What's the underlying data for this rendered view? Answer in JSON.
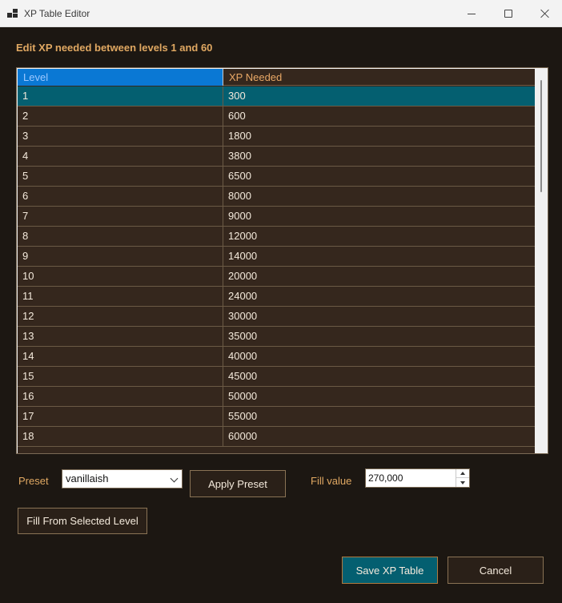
{
  "window": {
    "title": "XP Table Editor",
    "icon": "app-icon"
  },
  "heading": "Edit XP needed between levels 1 and 60",
  "grid": {
    "columns": [
      "Level",
      "XP Needed"
    ],
    "selected_row": 0,
    "rows": [
      {
        "level": "1",
        "xp": "300"
      },
      {
        "level": "2",
        "xp": "600"
      },
      {
        "level": "3",
        "xp": "1800"
      },
      {
        "level": "4",
        "xp": "3800"
      },
      {
        "level": "5",
        "xp": "6500"
      },
      {
        "level": "6",
        "xp": "8000"
      },
      {
        "level": "7",
        "xp": "9000"
      },
      {
        "level": "8",
        "xp": "12000"
      },
      {
        "level": "9",
        "xp": "14000"
      },
      {
        "level": "10",
        "xp": "20000"
      },
      {
        "level": "11",
        "xp": "24000"
      },
      {
        "level": "12",
        "xp": "30000"
      },
      {
        "level": "13",
        "xp": "35000"
      },
      {
        "level": "14",
        "xp": "40000"
      },
      {
        "level": "15",
        "xp": "45000"
      },
      {
        "level": "16",
        "xp": "50000"
      },
      {
        "level": "17",
        "xp": "55000"
      },
      {
        "level": "18",
        "xp": "60000"
      }
    ]
  },
  "preset": {
    "label": "Preset",
    "value": "vanillaish"
  },
  "apply_preset_label": "Apply Preset",
  "fill": {
    "label": "Fill value",
    "value": "270,000"
  },
  "fill_from_selected_label": "Fill From Selected Level",
  "save_label": "Save XP Table",
  "cancel_label": "Cancel",
  "colors": {
    "background": "#1c1712",
    "grid_row": "#35271d",
    "selected_row": "#045f70",
    "header_selected": "#0a78d4",
    "accent_text": "#e0a862",
    "primary_button": "#045f70"
  }
}
